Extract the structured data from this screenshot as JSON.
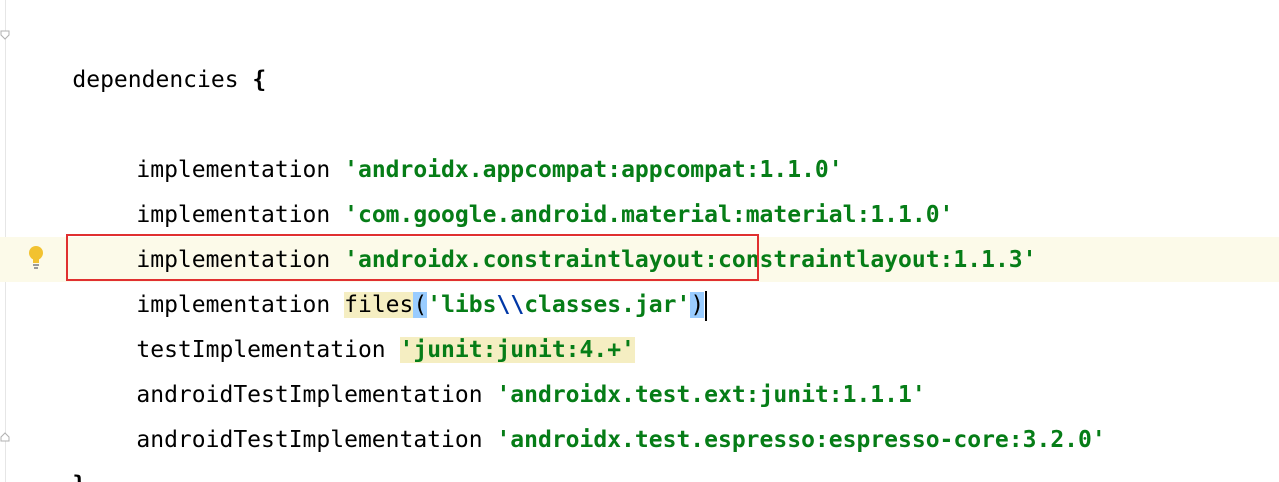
{
  "editor": {
    "header": "dependencies",
    "open_brace": "{",
    "close_brace": "}",
    "lines": [
      {
        "keyword": "implementation",
        "artifact": "'androidx.appcompat:appcompat:1.1.0'"
      },
      {
        "keyword": "implementation",
        "artifact": "'com.google.android.material:material:1.1.0'"
      },
      {
        "keyword": "implementation",
        "artifact": "'androidx.constraintlayout:constraintlayout:1.1.3'"
      },
      {
        "keyword": "implementation",
        "function": "files",
        "paren_open": "(",
        "quote_open": "'libs",
        "escape": "\\\\",
        "string_rest": "classes.jar'",
        "paren_close": ")"
      },
      {
        "keyword": "testImplementation",
        "artifact": "'junit:junit:4.+'"
      },
      {
        "keyword": "androidTestImplementation",
        "artifact": "'androidx.test.ext:junit:1.1.1'"
      },
      {
        "keyword": "androidTestImplementation",
        "artifact": "'androidx.test.espresso:espresso-core:3.2.0'"
      }
    ]
  },
  "colors": {
    "string": "#067d17",
    "escape": "#0037a6",
    "current_line": "#fcfae9",
    "paren_match": "#99ccff",
    "highlight_box": "#e03030"
  },
  "icons": {
    "gutter_hint": "lightbulb-icon",
    "fold_markers": [
      "fold-start-icon",
      "fold-end-icon"
    ]
  }
}
